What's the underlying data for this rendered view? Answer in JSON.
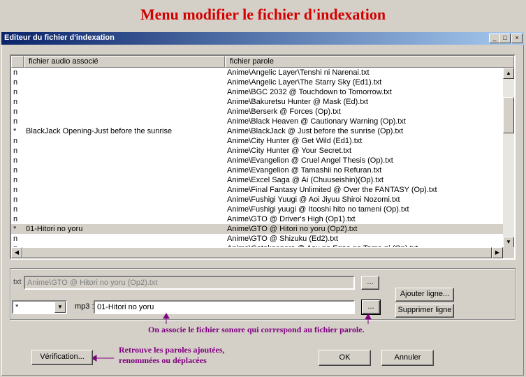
{
  "page_title": "Menu modifier le fichier d'indexation",
  "window": {
    "title": "Editeur du fichier d'indexation",
    "minimize_glyph": "_",
    "maximize_glyph": "□",
    "close_glyph": "×"
  },
  "list": {
    "columns": [
      "fichier audio associé",
      "fichier parole"
    ],
    "rows": [
      {
        "flag": "n",
        "audio": "",
        "lyrics": "Anime\\Angelic Layer\\Tenshi ni Narenai.txt"
      },
      {
        "flag": "n",
        "audio": "",
        "lyrics": "Anime\\Angelic Layer\\The Starry Sky (Ed1).txt"
      },
      {
        "flag": "n",
        "audio": "",
        "lyrics": "Anime\\BGC 2032 @ Touchdown to Tomorrow.txt"
      },
      {
        "flag": "n",
        "audio": "",
        "lyrics": "Anime\\Bakuretsu Hunter @ Mask (Ed).txt"
      },
      {
        "flag": "n",
        "audio": "",
        "lyrics": "Anime\\Berserk @ Forces (Op).txt"
      },
      {
        "flag": "n",
        "audio": "",
        "lyrics": "Anime\\Black Heaven @ Cautionary Warning (Op).txt"
      },
      {
        "flag": "*",
        "audio": "BlackJack Opening-Just before the sunrise",
        "lyrics": "Anime\\BlackJack @ Just before the sunrise (Op).txt"
      },
      {
        "flag": "n",
        "audio": "",
        "lyrics": "Anime\\City Hunter @ Get Wild (Ed1).txt"
      },
      {
        "flag": "n",
        "audio": "",
        "lyrics": "Anime\\City Hunter @ Your Secret.txt"
      },
      {
        "flag": "n",
        "audio": "",
        "lyrics": "Anime\\Evangelion @ Cruel Angel Thesis (Op).txt"
      },
      {
        "flag": "n",
        "audio": "",
        "lyrics": "Anime\\Evangelion @ Tamashii no Refuran.txt"
      },
      {
        "flag": "n",
        "audio": "",
        "lyrics": "Anime\\Excel Saga @ Ai (Chuuseishin)(Op).txt"
      },
      {
        "flag": "n",
        "audio": "",
        "lyrics": "Anime\\Final Fantasy Unlimited @ Over the FANTASY (Op).txt"
      },
      {
        "flag": "n",
        "audio": "",
        "lyrics": "Anime\\Fushigi Yuugi @ Aoi Jiyuu Shiroi Nozomi.txt"
      },
      {
        "flag": "n",
        "audio": "",
        "lyrics": "Anime\\Fushigi yuugi @ Itooshi hito no tameni (Op).txt"
      },
      {
        "flag": "n",
        "audio": "",
        "lyrics": "Anime\\GTO @ Driver's High (Op1).txt"
      },
      {
        "flag": "*",
        "audio": "01-Hitori no yoru",
        "lyrics": "Anime\\GTO @ Hitori no yoru (Op2).txt"
      },
      {
        "flag": "n",
        "audio": "",
        "lyrics": "Anime\\GTO @ Shizuku (Ed2).txt"
      },
      {
        "flag": "n",
        "audio": "",
        "lyrics": "Anime\\Gatekeepers @ Asu no Egao no Tame ni (Op).txt"
      }
    ]
  },
  "editor": {
    "txt_label": "txt :",
    "txt_value": "Anime\\GTO @ Hitori no yoru (Op2).txt",
    "browse_label": "...",
    "flag_value": "*",
    "mp3_label": "mp3 :",
    "mp3_value": "01-Hitori no yoru",
    "add_line_label": "Ajouter ligne...",
    "delete_line_label": "Supprimer ligne"
  },
  "buttons": {
    "verify_label": "Vérification...",
    "ok_label": "OK",
    "cancel_label": "Annuler"
  },
  "annotations": {
    "associate_note": "On associe le fichier sonore qui correspond au fichier parole.",
    "verify_note_line1": "Retrouve les paroles ajoutées,",
    "verify_note_line2": "renommées ou déplacées"
  },
  "colors": {
    "title_red": "#d40000",
    "annotation_purple": "#800080",
    "selection": "#d4d0c8",
    "window_bg": "#d4d0c8"
  }
}
